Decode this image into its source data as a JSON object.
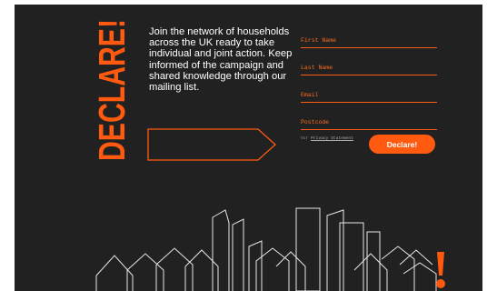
{
  "brand": {
    "wordmark": "DECLARE!"
  },
  "intro": {
    "text": "Join the network of households across the UK ready to take individual and joint action. Keep informed of the campaign and shared knowledge through our mailing list."
  },
  "form": {
    "first_name_placeholder": "First Name",
    "last_name_placeholder": "Last Name",
    "email_placeholder": "Email",
    "postcode_placeholder": "Postcode",
    "privacy_prefix": "Our",
    "privacy_link": "Privacy Statement",
    "submit_label": "Declare!"
  },
  "colors": {
    "background": "#212121",
    "accent": "#ff5a0f",
    "text": "#ffffff",
    "line": "#e6e6e6"
  },
  "icons": {
    "arrow_button": "arrow-right-outline-icon",
    "illustration": "skyline-illustration",
    "exclamation": "exclamation-icon"
  }
}
